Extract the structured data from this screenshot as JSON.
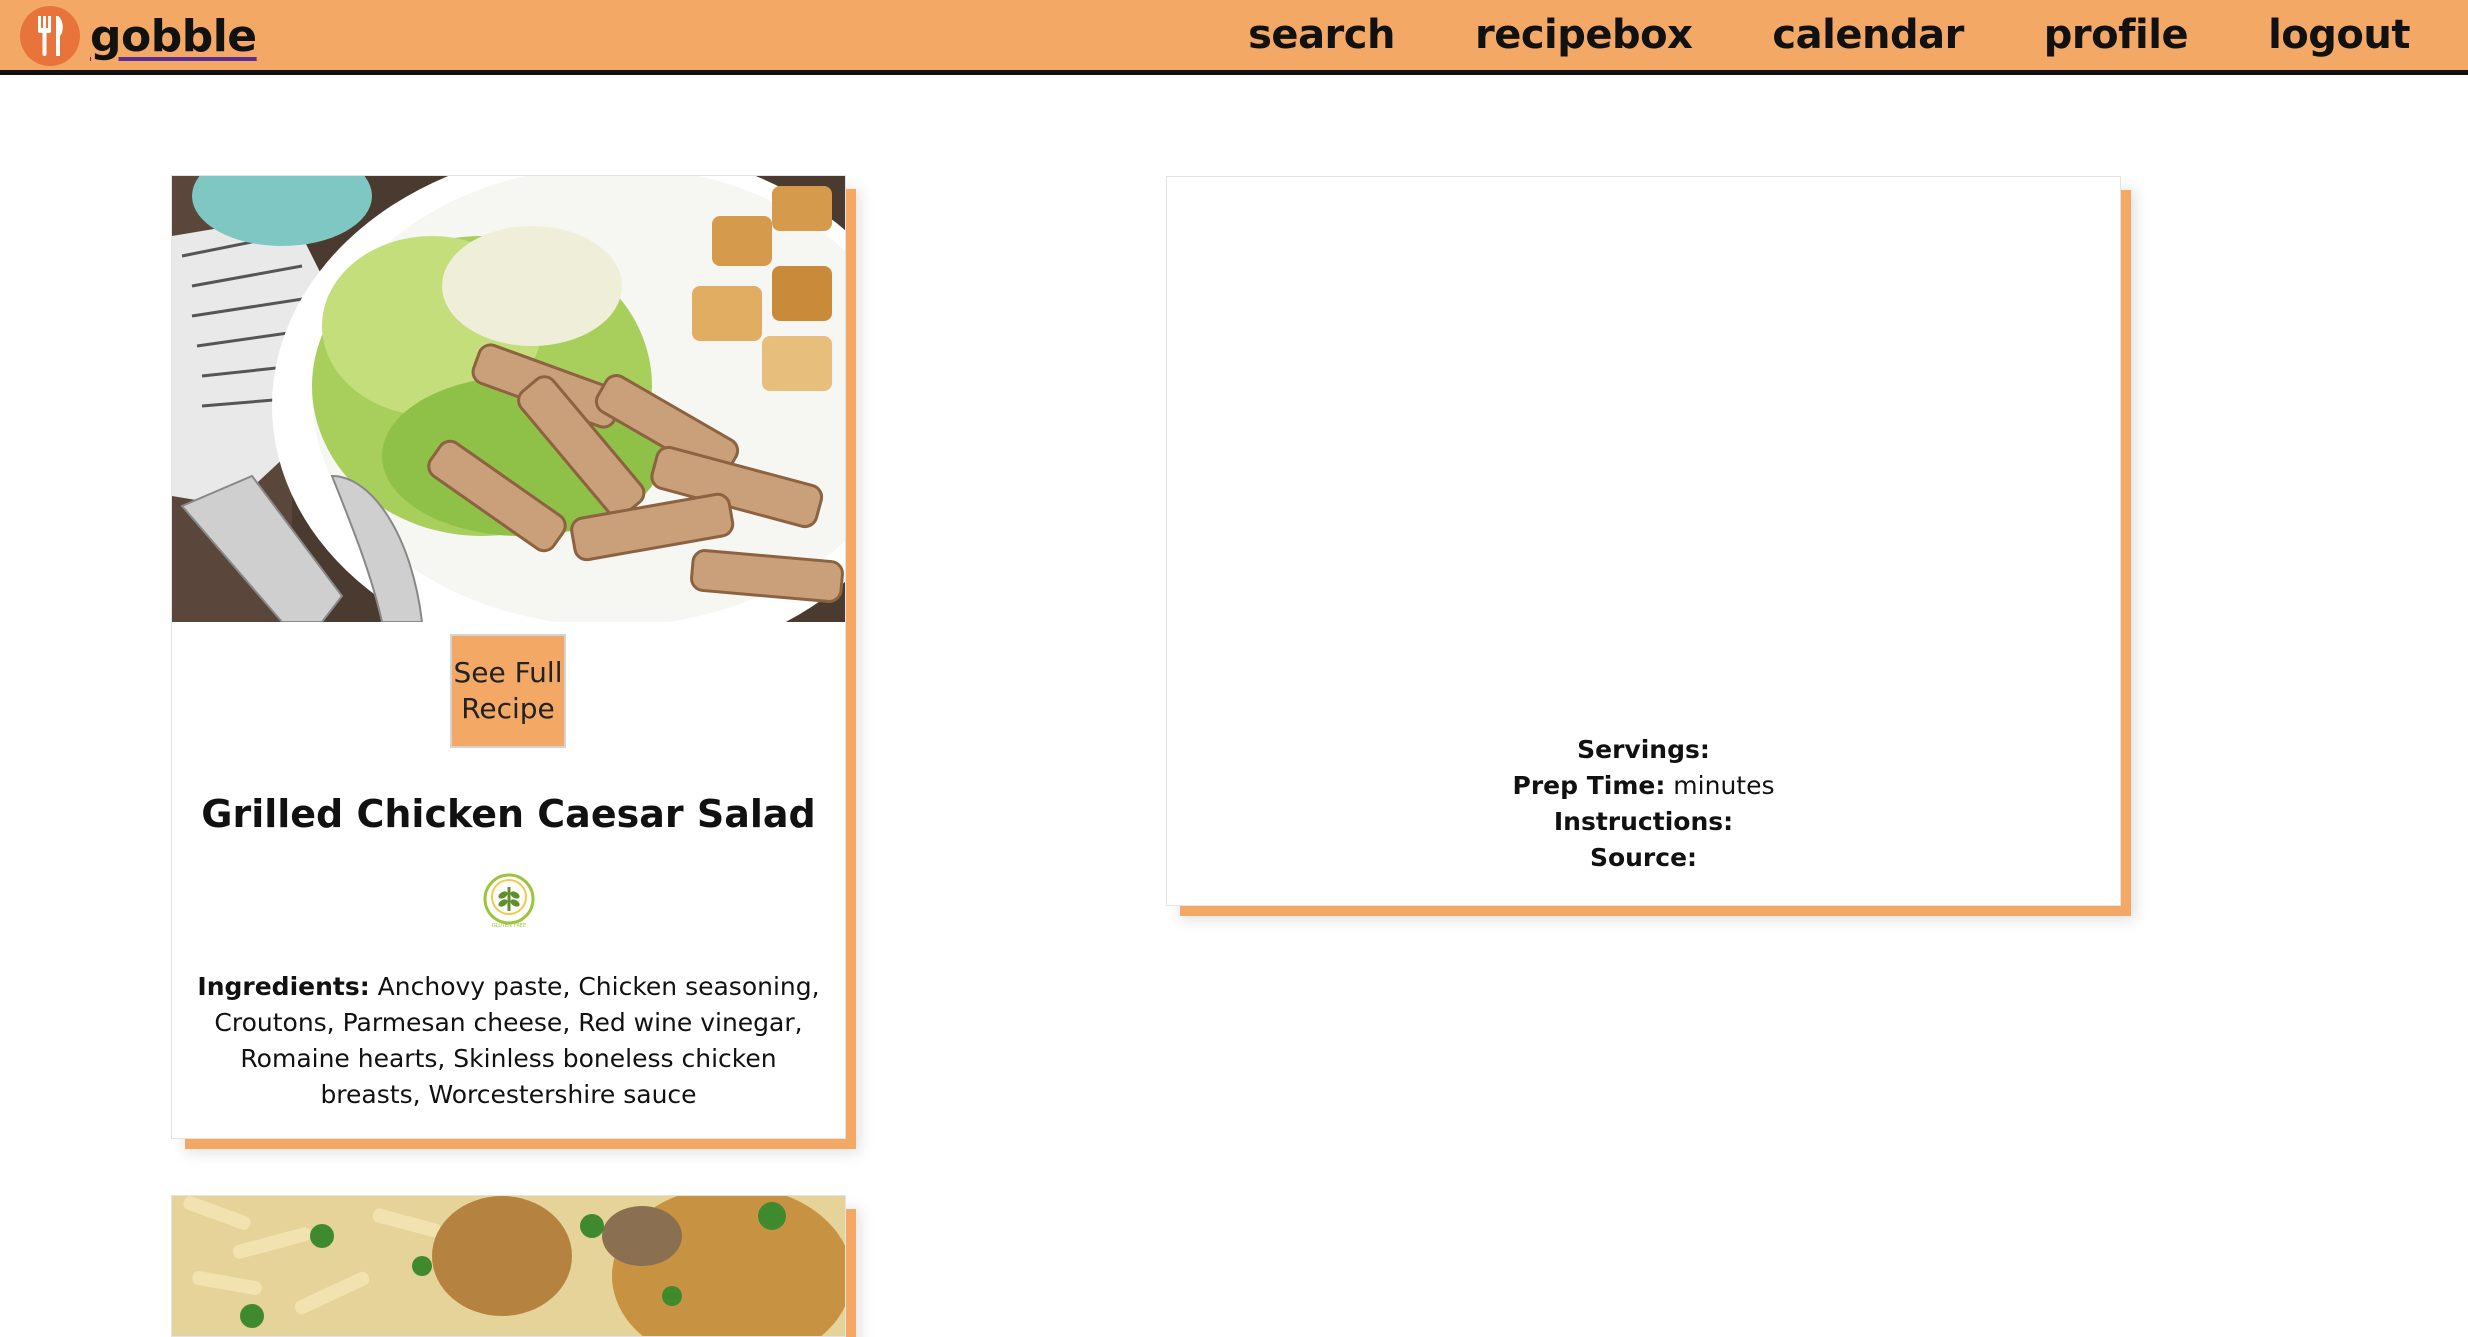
{
  "header": {
    "brand": "gobble",
    "nav": [
      "search",
      "recipebox",
      "calendar",
      "profile",
      "logout"
    ]
  },
  "recipes": [
    {
      "button_label": "See Full Recipe",
      "title": "Grilled Chicken Caesar Salad",
      "badge_text": "GLUTEN FREE",
      "ingredients_label": "Ingredients:",
      "ingredients": "Anchovy paste, Chicken seasoning, Croutons, Parmesan cheese, Red wine vinegar, Romaine hearts, Skinless boneless chicken breasts, Worcestershire sauce"
    }
  ],
  "detail": {
    "servings_label": "Servings:",
    "servings": "",
    "prep_label": "Prep Time:",
    "prep_value": "minutes",
    "instructions_label": "Instructions:",
    "instructions": "",
    "source_label": "Source:",
    "source": ""
  },
  "colors": {
    "header_bg": "#f3a866",
    "accent_shadow": "#f3a866",
    "logo": "#e8743b",
    "brand_underline": "#5b2e91"
  }
}
